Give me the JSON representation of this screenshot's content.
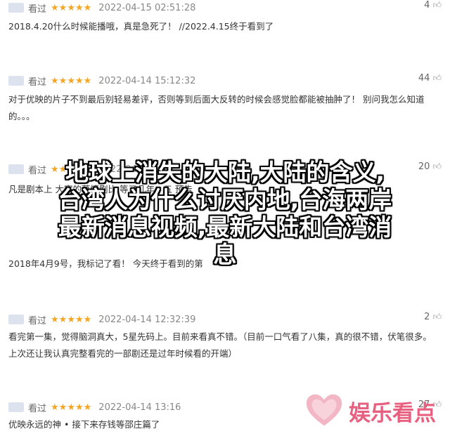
{
  "reviews": [
    {
      "user": "看过",
      "stars": "★★★★★",
      "date": "2022-04-15 02:51:28",
      "likes": "4",
      "text": "2018.4.20什么时候能播哦，真是急死了！ //2022.4.15终于看到了"
    },
    {
      "user": "看过",
      "stars": "★★★★★",
      "date": "2022-04-14 15:12:32",
      "likes": "44",
      "text": "对于优映的片子不到最后别轻易差评，否则等到后面大反转的时候会感觉脸都能被抽肿了！ 别问我怎么知道的。。。"
    },
    {
      "user": "看过",
      "stars": "★★★★★",
      "date": "2022-04-14",
      "likes": "20",
      "text": "凡是剧本上 大家的慕情剧比 等了几年，五 预告"
    },
    {
      "user": "",
      "stars": "",
      "date": "",
      "likes": "",
      "text": "2018年4月9号，我标记了看！ 今天终于看到的第"
    },
    {
      "user": "看过",
      "stars": "★★★★★",
      "date": "2022-04-14 12:32:39",
      "likes": "2",
      "text": "看完第一集，觉得脑洞真大，5星先码上。目前来看真不错。（目前一口气看了八集，真的很不错，伏笔很多。上次还让我认真完整看完的一部剧还是过年时候看的开端）"
    },
    {
      "user": "看过",
      "stars": "★★★★★",
      "date": "2022-04-14 13:16",
      "likes": "27",
      "text": "优映永远的神 • 接下来存钱等邵庄篇了"
    }
  ],
  "overlay_title": "地球上消失的大陆,大陆的含义,台湾人为什么讨厌内地,台海两岸最新消息视频,最新大陆和台湾消息",
  "overlay_lines": [
    "地球上消失的大陆,大陆的含义,",
    "台湾人为什么讨厌内地,台海两岸",
    "最新消息视频,最新大陆和台湾消",
    "息"
  ],
  "logo_text": "娱乐看点",
  "colors": {
    "star": "#f5a623",
    "logo": "#e8607f",
    "text": "#333333"
  },
  "icons": {
    "thumb": "thumbs-up-icon",
    "avatar": "avatar",
    "logo": "heart-logo-icon"
  }
}
